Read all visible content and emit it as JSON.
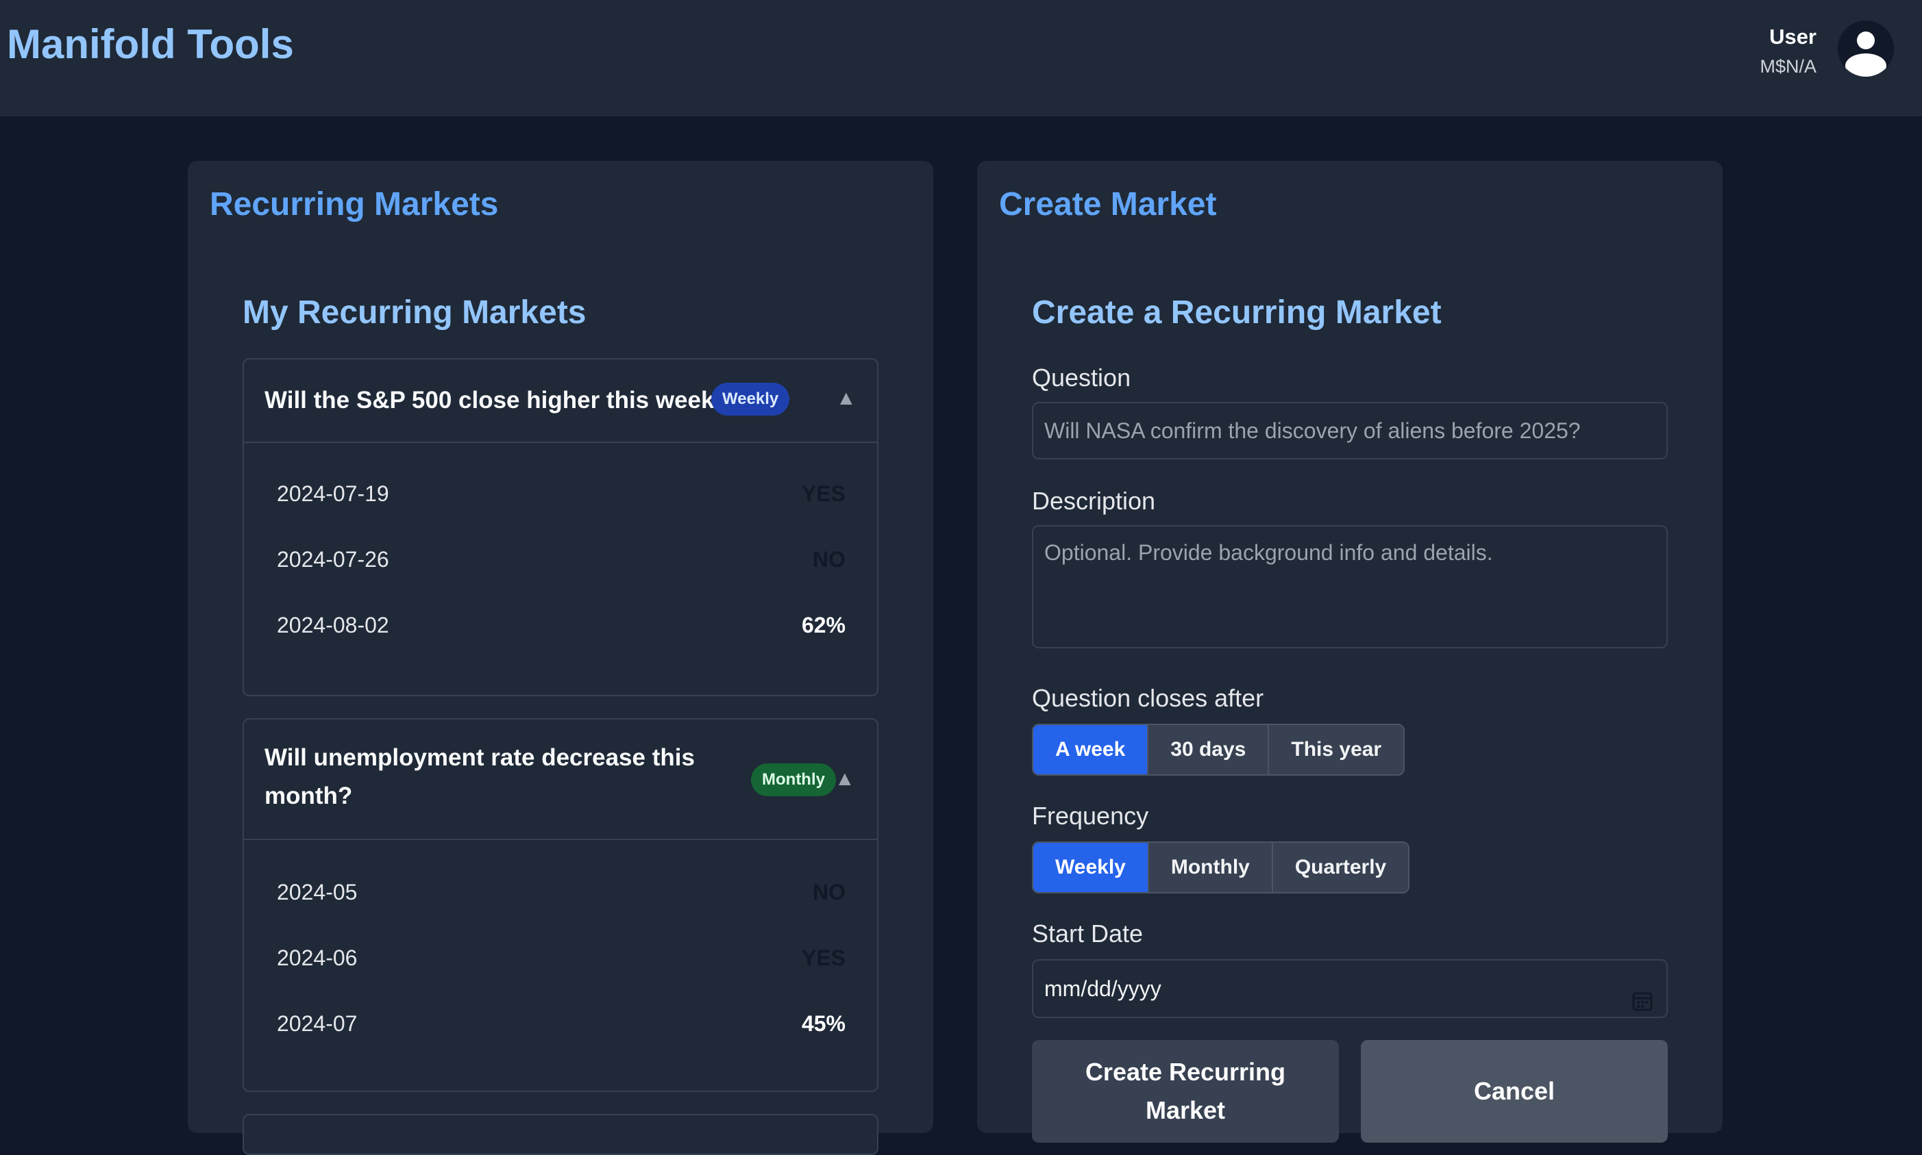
{
  "header": {
    "brand": "Manifold Tools",
    "user_name": "User",
    "user_balance": "M$N/A"
  },
  "left_panel": {
    "title": "Recurring Markets",
    "subtitle": "My Recurring Markets",
    "markets": [
      {
        "question": "Will the S&P 500 close higher this week?",
        "badge": "Weekly",
        "collapse_glyph": "▲",
        "rows": [
          {
            "date": "2024-07-19",
            "value": "YES"
          },
          {
            "date": "2024-07-26",
            "value": "NO"
          },
          {
            "date": "2024-08-02",
            "value": "62%"
          }
        ]
      },
      {
        "question_line1": "Will unemployment rate decrease this",
        "question_line2": "month?",
        "badge": "Monthly",
        "collapse_glyph": "▲",
        "rows": [
          {
            "date": "2024-05",
            "value": "NO"
          },
          {
            "date": "2024-06",
            "value": "YES"
          },
          {
            "date": "2024-07",
            "value": "45%"
          }
        ]
      }
    ]
  },
  "right_panel": {
    "title": "Create Market",
    "subtitle": "Create a Recurring Market",
    "question_label": "Question",
    "question_placeholder": "Will NASA confirm the discovery of aliens before 2025?",
    "description_label": "Description",
    "description_placeholder": "Optional. Provide background info and details.",
    "closes_label": "Question closes after",
    "closes_options": [
      "A week",
      "30 days",
      "This year"
    ],
    "frequency_label": "Frequency",
    "frequency_options": [
      "Weekly",
      "Monthly",
      "Quarterly"
    ],
    "start_date_label": "Start Date",
    "start_date_value": "mm/dd/yyyy",
    "create_button_line1": "Create Recurring",
    "create_button_line2": "Market",
    "cancel_button": "Cancel"
  }
}
